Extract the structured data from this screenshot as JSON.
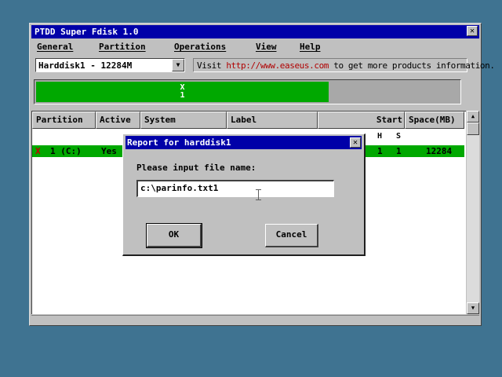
{
  "window": {
    "title": "PTDD Super Fdisk 1.0",
    "close_glyph": "✕"
  },
  "menu": {
    "items": [
      {
        "label": "General"
      },
      {
        "label": "Partition"
      },
      {
        "label": "Operations"
      },
      {
        "label": "View"
      },
      {
        "label": "Help"
      }
    ]
  },
  "disk_select": {
    "value": "Harddisk1 - 12284M",
    "arrow_glyph": "▼"
  },
  "visit": {
    "prefix": "Visit ",
    "link": "http://www.easeus.com",
    "suffix": " to get more products information."
  },
  "disk_map": {
    "partition_marker": "X",
    "partition_number": "1",
    "used_fraction": 0.69,
    "partition_color": "#00a800"
  },
  "table": {
    "columns": [
      "Partition",
      "Active",
      "System",
      "Label",
      "Start",
      "Space(MB)"
    ],
    "subcolumns": [
      "H",
      "S"
    ],
    "rows": [
      {
        "marker": "X",
        "partition": "1 (C:)",
        "active": "Yes",
        "start_h": "1",
        "start_s": "1",
        "space": "12284"
      }
    ]
  },
  "scrollbar": {
    "up_glyph": "▲",
    "down_glyph": "▼"
  },
  "dialog": {
    "title": "Report for harddisk1",
    "close_glyph": "✕",
    "prompt": "Please input file name:",
    "input_value": "c:\\parinfo.txt1",
    "ok_label": "OK",
    "cancel_label": "Cancel"
  },
  "colors": {
    "desktop": "#3f7391",
    "titlebar": "#0000a8",
    "partition_green": "#00a800",
    "marker_red": "#c00000",
    "link_red": "#b00000"
  }
}
